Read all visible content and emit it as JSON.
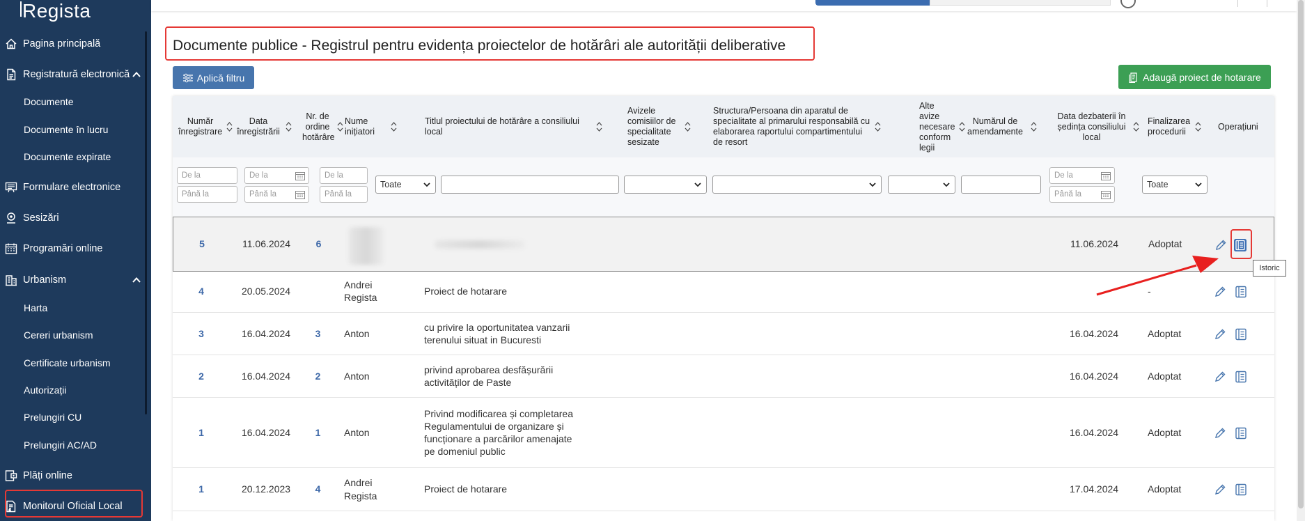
{
  "sidebar": {
    "logo": "Regista",
    "items": [
      {
        "label": "Pagina principală",
        "icon": "home-icon"
      },
      {
        "label": "Registratură electronică",
        "icon": "document-icon"
      },
      {
        "label": "Documente"
      },
      {
        "label": "Documente în lucru"
      },
      {
        "label": "Documente expirate"
      },
      {
        "label": "Formulare electronice",
        "icon": "form-icon"
      },
      {
        "label": "Sesizări",
        "icon": "location-pin-icon"
      },
      {
        "label": "Programări online",
        "icon": "calendar-icon"
      },
      {
        "label": "Urbanism",
        "icon": "building-icon"
      },
      {
        "label": "Harta"
      },
      {
        "label": "Cereri urbanism"
      },
      {
        "label": "Certificate urbanism"
      },
      {
        "label": "Autorizații"
      },
      {
        "label": "Prelungiri CU"
      },
      {
        "label": "Prelungiri AC/AD"
      },
      {
        "label": "Plăți online",
        "icon": "payment-icon"
      },
      {
        "label": "Monitorul Oficial Local",
        "icon": "monitor-icon"
      }
    ]
  },
  "page": {
    "title": "Documente publice - Registrul pentru evidența proiectelor de hotărâri ale autorității deliberative",
    "filter_button": "Aplică filtru",
    "add_button": "Adaugă proiect de hotarare"
  },
  "table": {
    "headers": [
      "Număr înregistrare",
      "Data înregistrării",
      "Nr. de ordine hotărâre",
      "Nume inițiatori",
      "Titlul proiectului de hotărâre a consiliului local",
      "Avizele comisiilor de specialitate sesizate",
      "Structura/Persoana din aparatul de specialitate al primarului responsabilă cu elaborarea raportului compartimentului de resort",
      "Alte avize necesare conform legii",
      "Numărul de amendamente",
      "Data dezbaterii în ședința consiliului local",
      "Finalizarea procedurii",
      "Operațiuni"
    ],
    "filters": {
      "from_placeholder": "De la",
      "to_placeholder": "Până la",
      "initiators_select": "Toate",
      "finalization_select": "Toate"
    },
    "rows": [
      {
        "nr": "5",
        "date": "11.06.2024",
        "order": "6",
        "initiators": "",
        "title": "",
        "debate_date": "11.06.2024",
        "status": "Adoptat"
      },
      {
        "nr": "4",
        "date": "20.05.2024",
        "order": "",
        "initiators": "Andrei Regista",
        "title": "Proiect de hotarare",
        "debate_date": "",
        "status": "-"
      },
      {
        "nr": "3",
        "date": "16.04.2024",
        "order": "3",
        "initiators": "Anton",
        "title": "cu privire la oportunitatea vanzarii terenului situat in Bucuresti",
        "debate_date": "16.04.2024",
        "status": "Adoptat"
      },
      {
        "nr": "2",
        "date": "16.04.2024",
        "order": "2",
        "initiators": "Anton",
        "title": "privind aprobarea desfășurării activităților de Paste",
        "debate_date": "16.04.2024",
        "status": "Adoptat"
      },
      {
        "nr": "1",
        "date": "16.04.2024",
        "order": "1",
        "initiators": "Anton",
        "title": "Privind modificarea și completarea Regulamentului de organizare și funcționare a parcărilor amenajate pe domeniul public",
        "debate_date": "16.04.2024",
        "status": "Adoptat"
      },
      {
        "nr": "1",
        "date": "20.12.2023",
        "order": "4",
        "initiators": "Andrei Regista",
        "title": "Proiect de hotarare",
        "debate_date": "17.04.2024",
        "status": "Adoptat"
      }
    ]
  },
  "tooltip": "Istoric",
  "colors": {
    "sidebar_bg": "#1e3a5c",
    "primary": "#4775ad",
    "success": "#3c9f54",
    "highlight": "#e53935"
  }
}
